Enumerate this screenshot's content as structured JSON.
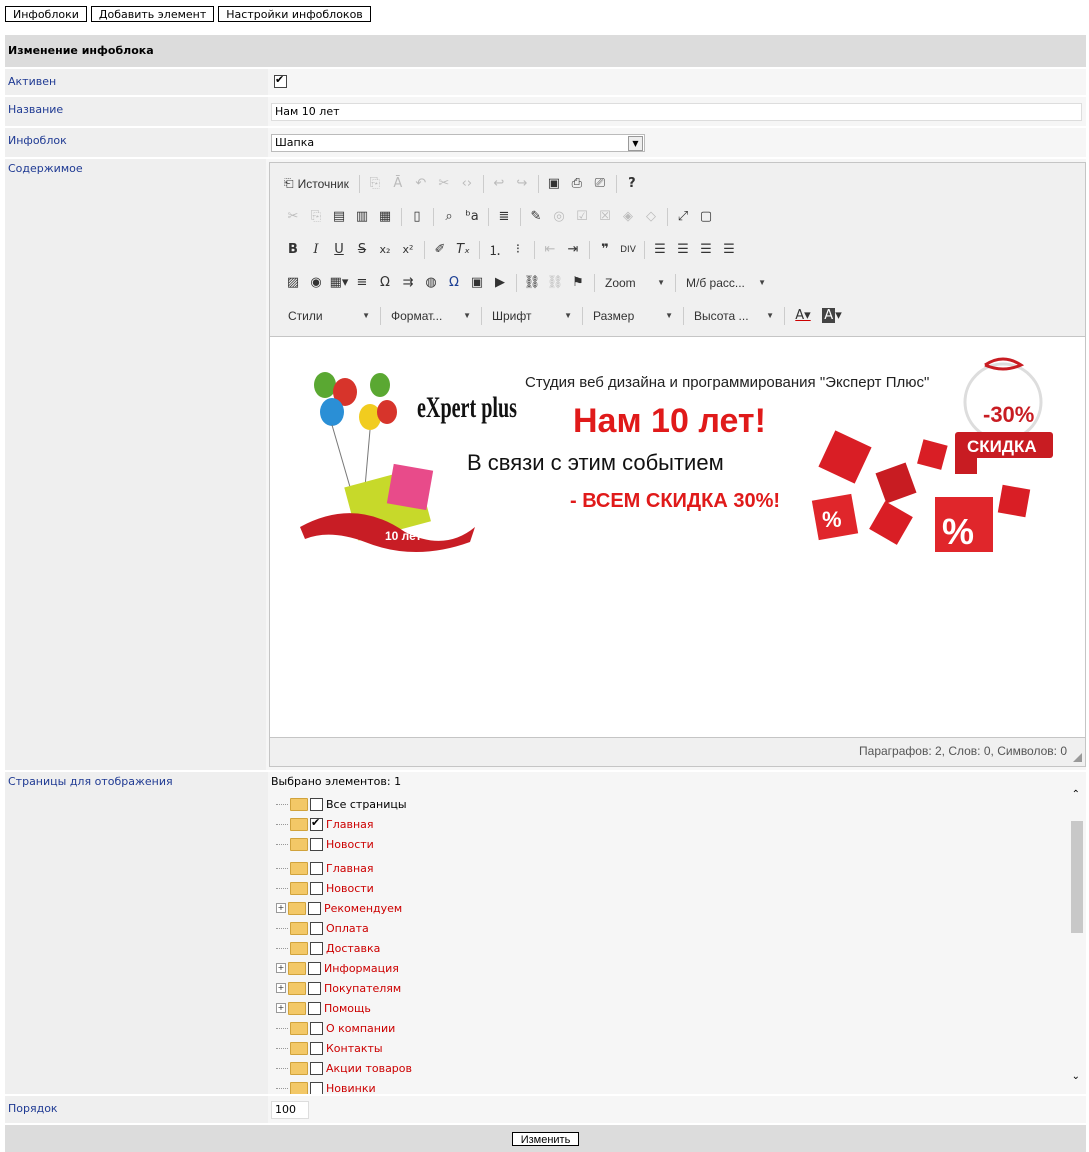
{
  "top_buttons": [
    "Инфоблоки",
    "Добавить элемент",
    "Настройки инфоблоков"
  ],
  "form": {
    "header": "Изменение инфоблока",
    "active_label": "Активен",
    "active_checked": true,
    "name_label": "Название",
    "name_value": "Нам 10 лет",
    "infoblock_label": "Инфоблок",
    "infoblock_value": "Шапка",
    "content_label": "Содержимое",
    "pages_label": "Страницы для отображения",
    "order_label": "Порядок",
    "order_value": "100",
    "submit_label": "Изменить"
  },
  "editor": {
    "source_label": "Источник",
    "zoom_label": "Zoom",
    "mb_label": "М/б расс...",
    "styles_label": "Стили",
    "format_label": "Формат...",
    "font_label": "Шрифт",
    "size_label": "Размер",
    "height_label": "Высота ...",
    "status": "Параграфов: 2, Слов: 0, Символов: 0"
  },
  "banner": {
    "logo": "eXpert plus",
    "studio": "Студия веб дизайна и программирования \"Эксперт Плюс\"",
    "headline": "Нам 10 лет!",
    "line2": "В связи с этим событием",
    "line3": "- ВСЕМ СКИДКА 30%!",
    "ribbon": "10 лет",
    "badge_pct": "-30%",
    "badge_text": "СКИДКА",
    "cube_symbol": "%"
  },
  "tree": {
    "selected_count": "Выбрано элементов: 1",
    "items": [
      {
        "label": "Все страницы",
        "checked": false,
        "black": true,
        "expand": false
      },
      {
        "label": "Главная",
        "checked": true,
        "black": false,
        "expand": false
      },
      {
        "label": "Новости",
        "checked": false,
        "black": false,
        "expand": false
      },
      {
        "label": "Главная",
        "checked": false,
        "black": false,
        "expand": false
      },
      {
        "label": "Новости",
        "checked": false,
        "black": false,
        "expand": false
      },
      {
        "label": "Рекомендуем",
        "checked": false,
        "black": false,
        "expand": true
      },
      {
        "label": "Оплата",
        "checked": false,
        "black": false,
        "expand": false
      },
      {
        "label": "Доставка",
        "checked": false,
        "black": false,
        "expand": false
      },
      {
        "label": "Информация",
        "checked": false,
        "black": false,
        "expand": true
      },
      {
        "label": "Покупателям",
        "checked": false,
        "black": false,
        "expand": true
      },
      {
        "label": "Помощь",
        "checked": false,
        "black": false,
        "expand": true
      },
      {
        "label": "О компании",
        "checked": false,
        "black": false,
        "expand": false
      },
      {
        "label": "Контакты",
        "checked": false,
        "black": false,
        "expand": false
      },
      {
        "label": "Акции товаров",
        "checked": false,
        "black": false,
        "expand": false
      },
      {
        "label": "Новинки",
        "checked": false,
        "black": false,
        "expand": false
      }
    ]
  }
}
